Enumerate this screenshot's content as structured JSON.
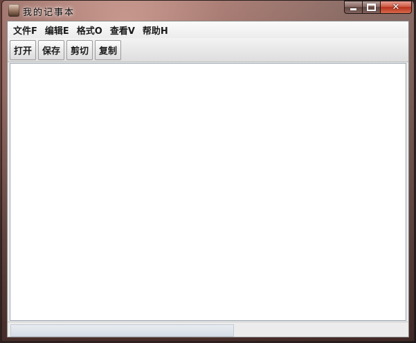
{
  "window": {
    "title": "我的记事本",
    "icon": "notepad-app-icon",
    "caption": {
      "minimize_icon": "minimize-icon",
      "maximize_icon": "maximize-icon",
      "close_icon": "close-icon",
      "close_glyph": "✕"
    }
  },
  "menubar": {
    "items": [
      {
        "label": "文件F"
      },
      {
        "label": "编辑E"
      },
      {
        "label": "格式O"
      },
      {
        "label": "查看V"
      },
      {
        "label": "帮助H"
      }
    ]
  },
  "toolbar": {
    "buttons": [
      {
        "label": "打开"
      },
      {
        "label": "保存"
      },
      {
        "label": "剪切"
      },
      {
        "label": "复制"
      }
    ]
  },
  "editor": {
    "value": ""
  },
  "statusbar": {
    "text": ""
  }
}
